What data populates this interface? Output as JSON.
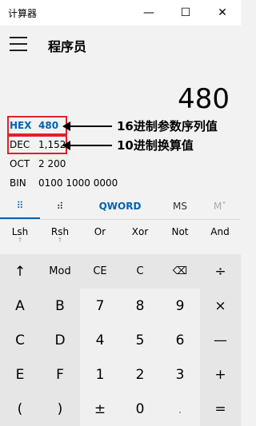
{
  "window": {
    "title": "计算器",
    "minimize": "—",
    "maximize": "☐",
    "close": "✕"
  },
  "mode": {
    "title": "程序员"
  },
  "display": {
    "value": "480"
  },
  "radix": {
    "hex": {
      "name": "HEX",
      "value": "480"
    },
    "dec": {
      "name": "DEC",
      "value": "1,152"
    },
    "oct": {
      "name": "OCT",
      "value": "2 200"
    },
    "bin": {
      "name": "BIN",
      "value": "0100 1000 0000"
    }
  },
  "annotations": {
    "hex": "16进制参数序列值",
    "dec": "10进制换算值"
  },
  "tabs": {
    "keypad": "⠿",
    "bits": "⠾",
    "word": "QWORD",
    "ms": "MS",
    "mr": "M˅"
  },
  "shift": {
    "lsh": "Lsh",
    "rsh": "Rsh",
    "or": "Or",
    "xor": "Xor",
    "not": "Not",
    "and": "And",
    "sub_arrow": "↑"
  },
  "keys": {
    "up": "↑",
    "mod": "Mod",
    "ce": "CE",
    "c": "C",
    "back": "⌫",
    "divide": "÷",
    "a": "A",
    "b": "B",
    "seven": "7",
    "eight": "8",
    "nine": "9",
    "multiply": "×",
    "cc": "C",
    "d": "D",
    "four": "4",
    "five": "5",
    "six": "6",
    "minus": "—",
    "e": "E",
    "f": "F",
    "one": "1",
    "two": "2",
    "three": "3",
    "plus": "+",
    "lparen": "(",
    "rparen": ")",
    "negate": "±",
    "zero": "0",
    "dot": ".",
    "equals": "="
  }
}
